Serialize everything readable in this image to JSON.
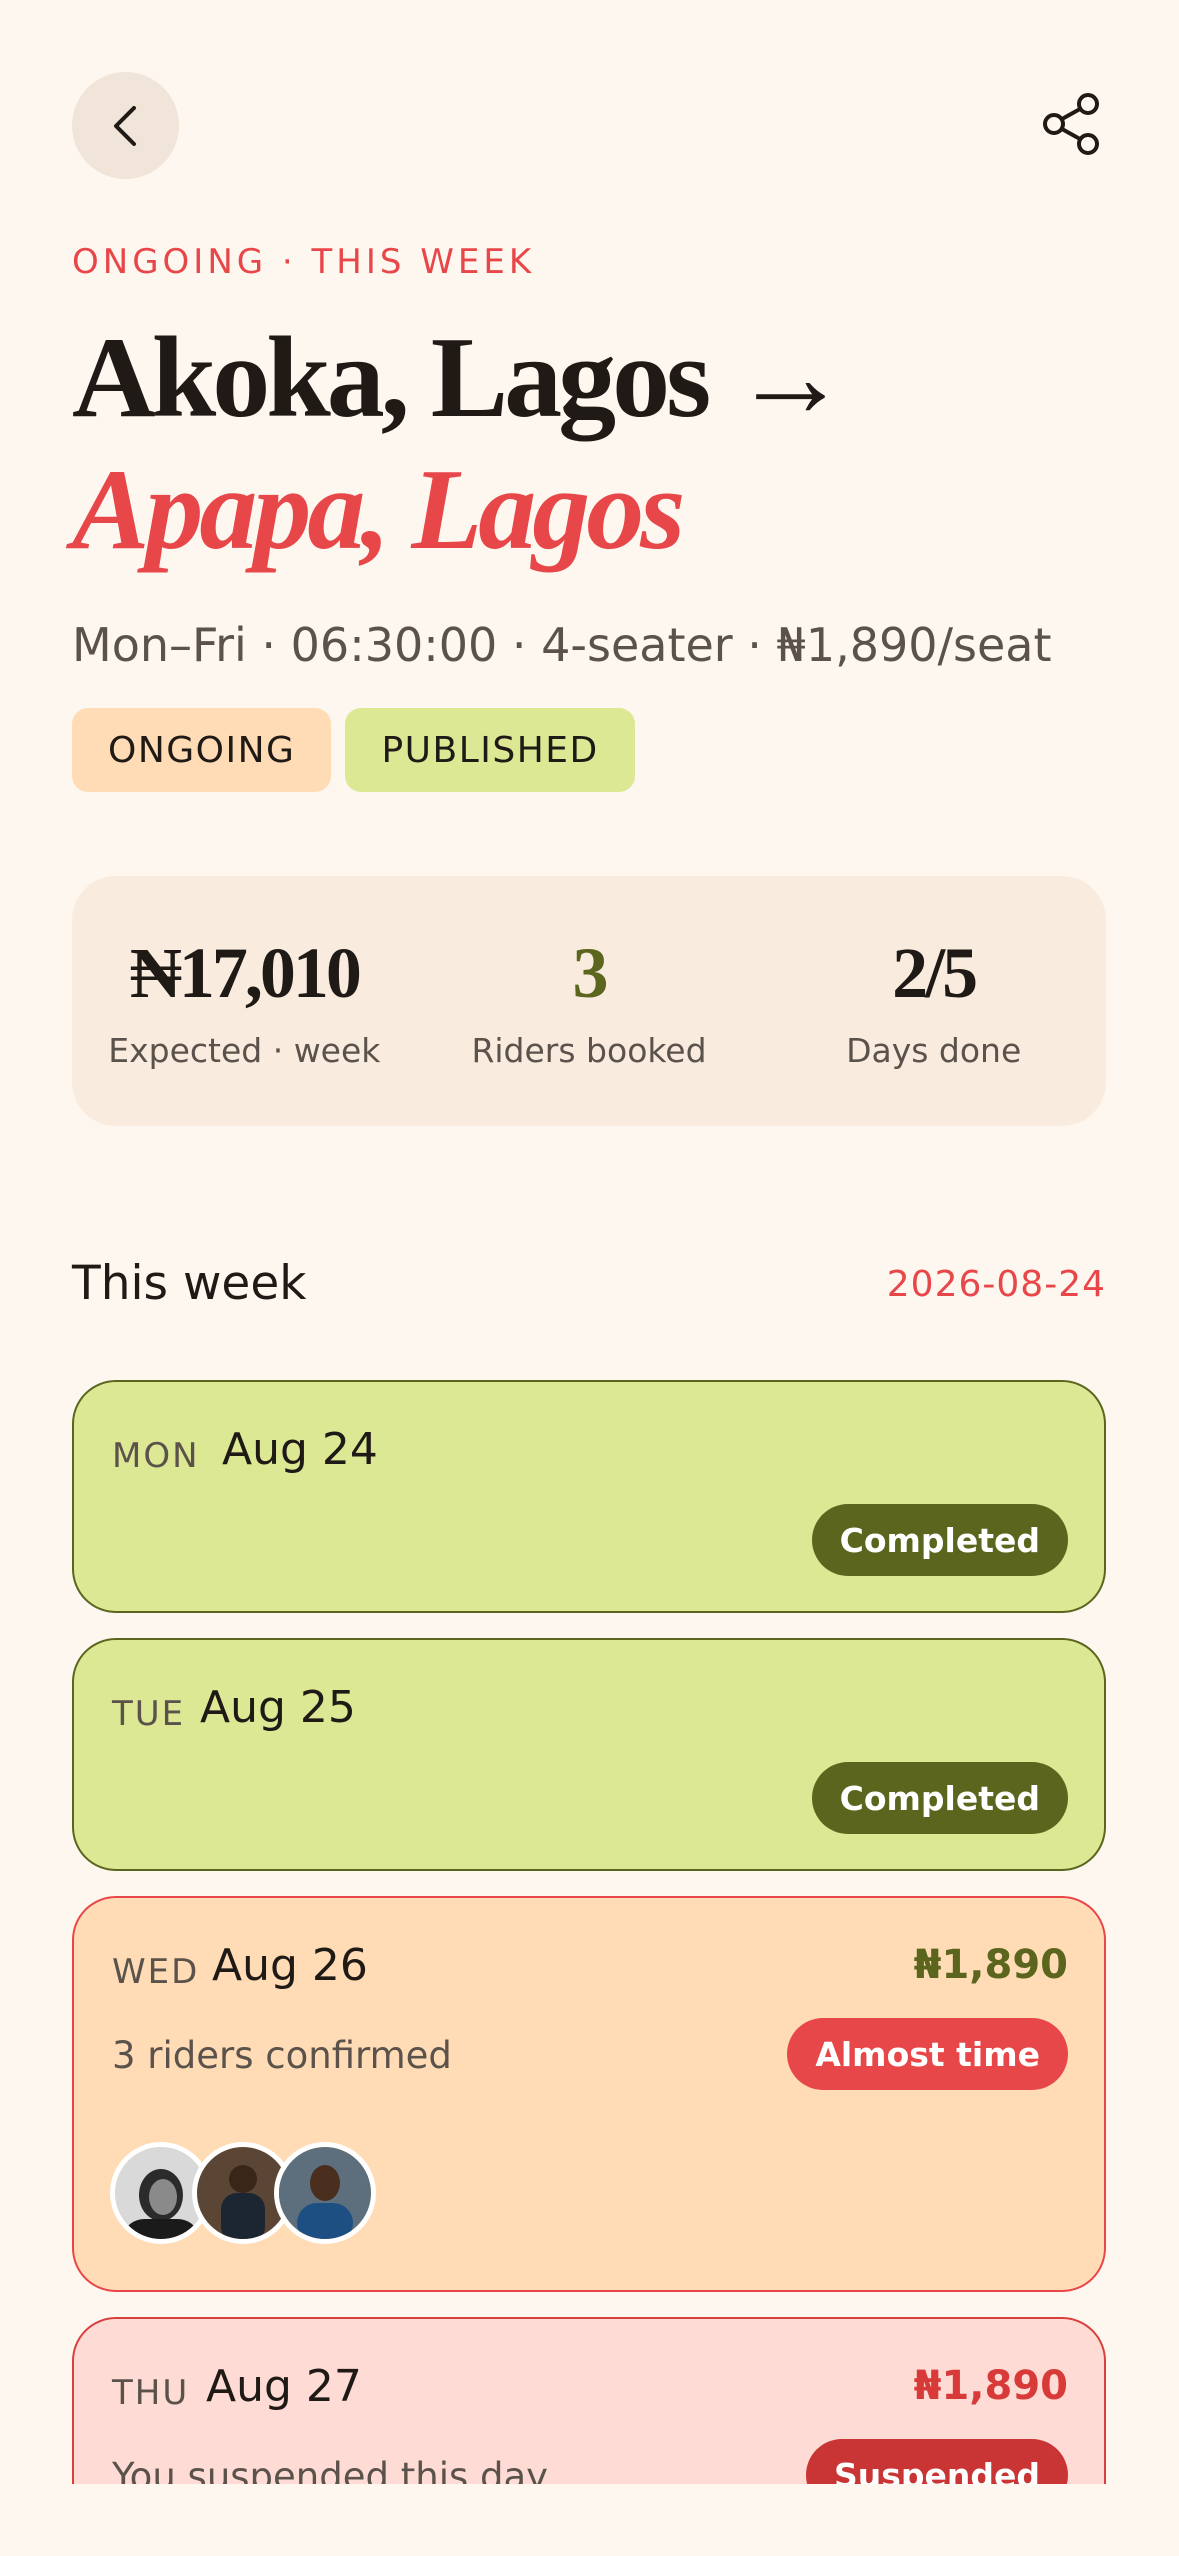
{
  "header": {
    "back_icon": "chevron-left-icon",
    "share_icon": "share-icon",
    "eyebrow": "ONGOING · THIS WEEK",
    "origin": "Akoka, Lagos →",
    "destination": "Apapa, Lagos",
    "meta": "Mon–Fri · 06:30:00 · 4-seater · ₦1,890/seat",
    "pills": [
      "ONGOING",
      "PUBLISHED"
    ]
  },
  "stats": {
    "expected_value": "₦17,010",
    "expected_label": "Expected · week",
    "riders_value": "3",
    "riders_label": "Riders booked",
    "days_value": "2/5",
    "days_label": "Days done"
  },
  "week": {
    "title": "This week",
    "date": "2026-08-24",
    "days": [
      {
        "dow": "MON",
        "date": "Aug 24",
        "status": "Completed"
      },
      {
        "dow": "TUE",
        "date": "Aug 25",
        "status": "Completed"
      },
      {
        "dow": "WED",
        "date": "Aug 26",
        "price": "₦1,890",
        "subtitle": "3 riders confirmed",
        "status": "Almost time"
      },
      {
        "dow": "THU",
        "date": "Aug 27",
        "price": "₦1,890",
        "subtitle": "You suspended this day",
        "status": "Suspended"
      }
    ]
  },
  "colors": {
    "accent": "#e8474a",
    "olive": "#5b651d",
    "lime": "#dce894",
    "peach": "#ffdcb5",
    "background": "#fdf7f0"
  }
}
